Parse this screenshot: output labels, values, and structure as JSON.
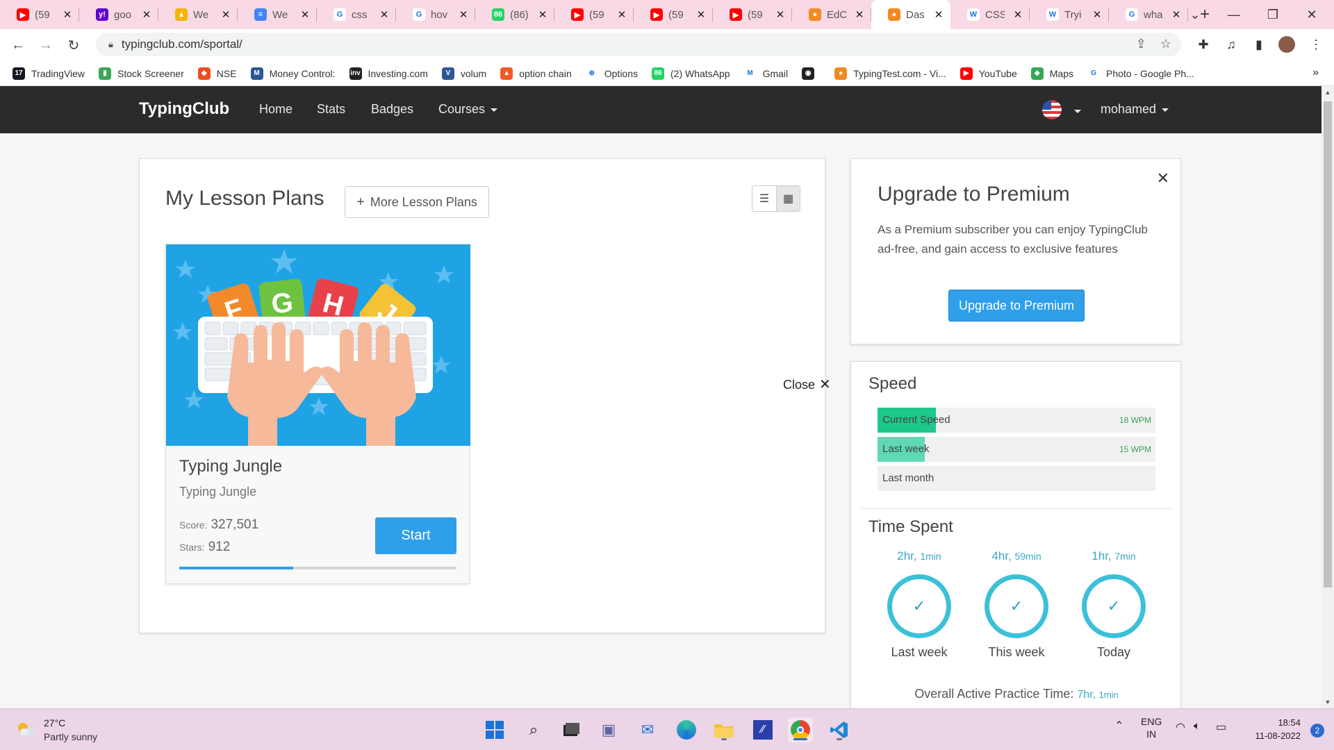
{
  "browser": {
    "tabs": [
      {
        "title": "(59",
        "favicon": "youtube-icon",
        "color": "#ff0000",
        "glyph": "▶"
      },
      {
        "title": "goo",
        "favicon": "yahoo-icon",
        "color": "#6001d2",
        "glyph": "y!"
      },
      {
        "title": "We",
        "favicon": "google-drive-icon",
        "color": "#f4b400",
        "glyph": "▲"
      },
      {
        "title": "We",
        "favicon": "google-docs-icon",
        "color": "#4285f4",
        "glyph": "≡"
      },
      {
        "title": "css",
        "favicon": "google-icon",
        "color": "#ffffff",
        "glyph": "G"
      },
      {
        "title": "hov",
        "favicon": "google-icon",
        "color": "#ffffff",
        "glyph": "G"
      },
      {
        "title": "(86)",
        "favicon": "whatsapp-icon",
        "color": "#25d366",
        "glyph": "86"
      },
      {
        "title": "(59",
        "favicon": "youtube-icon",
        "color": "#ff0000",
        "glyph": "▶"
      },
      {
        "title": "(59",
        "favicon": "youtube-icon",
        "color": "#ff0000",
        "glyph": "▶"
      },
      {
        "title": "(59",
        "favicon": "youtube-icon",
        "color": "#ff0000",
        "glyph": "▶"
      },
      {
        "title": "EdC",
        "favicon": "typingclub-icon",
        "color": "#f08a24",
        "glyph": "●"
      },
      {
        "title": "Das",
        "favicon": "typingclub-icon",
        "color": "#f08a24",
        "glyph": "●",
        "active": true
      },
      {
        "title": "CSS",
        "favicon": "w3schools-icon",
        "color": "#ffffff",
        "glyph": "W"
      },
      {
        "title": "Tryi",
        "favicon": "w3schools-icon",
        "color": "#ffffff",
        "glyph": "W"
      },
      {
        "title": "wha",
        "favicon": "google-icon",
        "color": "#ffffff",
        "glyph": "G"
      }
    ],
    "url": "typingclub.com/sportal/"
  },
  "bookmarks": [
    {
      "label": "TradingView",
      "icon": "tradingview-icon",
      "color": "#131722",
      "glyph": "17"
    },
    {
      "label": "Stock Screener",
      "icon": "bar-chart-icon",
      "color": "#3aa757",
      "glyph": "▮"
    },
    {
      "label": "NSE",
      "icon": "nse-icon",
      "color": "#e8501e",
      "glyph": "◆"
    },
    {
      "label": "Money Control:",
      "icon": "moneycontrol-icon",
      "color": "#2b5797",
      "glyph": "M"
    },
    {
      "label": "Investing.com",
      "icon": "investing-icon",
      "color": "#222222",
      "glyph": "inv"
    },
    {
      "label": "volum",
      "icon": "volume-icon",
      "color": "#2b5797",
      "glyph": "V"
    },
    {
      "label": "option chain",
      "icon": "option-chain-icon",
      "color": "#f05a28",
      "glyph": "▲"
    },
    {
      "label": "Options",
      "icon": "link-icon",
      "color": "#ffffff",
      "glyph": "⊕"
    },
    {
      "label": "(2) WhatsApp",
      "icon": "whatsapp-icon",
      "color": "#25d366",
      "glyph": "86"
    },
    {
      "label": "Gmail",
      "icon": "gmail-icon",
      "color": "#ffffff",
      "glyph": "M"
    },
    {
      "label": "",
      "icon": "globe-icon",
      "color": "#222222",
      "glyph": "◉"
    },
    {
      "label": "TypingTest.com - Vi...",
      "icon": "typingtest-icon",
      "color": "#f08a24",
      "glyph": "●"
    },
    {
      "label": "YouTube",
      "icon": "youtube-icon",
      "color": "#ff0000",
      "glyph": "▶"
    },
    {
      "label": "Maps",
      "icon": "maps-icon",
      "color": "#34a853",
      "glyph": "◆"
    },
    {
      "label": "Photo - Google Ph...",
      "icon": "google-icon",
      "color": "#ffffff",
      "glyph": "G"
    }
  ],
  "navbar": {
    "brand": "TypingClub",
    "links": [
      "Home",
      "Stats",
      "Badges"
    ],
    "courses": "Courses",
    "user": "mohamed"
  },
  "lessons": {
    "title": "My Lesson Plans",
    "more_label": "More Lesson Plans",
    "card": {
      "title": "Typing Jungle",
      "subtitle": "Typing Jungle",
      "score_label": "Score:",
      "score": "327,501",
      "stars_label": "Stars:",
      "stars": "912",
      "start_label": "Start",
      "progress": 0.41,
      "letters": [
        "F",
        "G",
        "H",
        "J"
      ]
    },
    "close_label": "Close"
  },
  "premium": {
    "title": "Upgrade to Premium",
    "text": "As a Premium subscriber you can enjoy TypingClub ad-free, and gain access to exclusive features",
    "button": "Upgrade to Premium"
  },
  "speed": {
    "title": "Speed",
    "rows": [
      {
        "label": "Current Speed",
        "value": "18 WPM",
        "fill": 0.21,
        "color": "#1ec88a"
      },
      {
        "label": "Last week",
        "value": "15 WPM",
        "fill": 0.17,
        "color": "#5ed9b4"
      },
      {
        "label": "Last month",
        "value": "",
        "fill": 0,
        "color": "#1ec88a"
      }
    ]
  },
  "time_spent": {
    "title": "Time Spent",
    "items": [
      {
        "h": "2hr,",
        "m": "1min",
        "label": "Last week"
      },
      {
        "h": "4hr,",
        "m": "59min",
        "label": "This week"
      },
      {
        "h": "1hr,",
        "m": "7min",
        "label": "Today"
      }
    ],
    "overall_label": "Overall Active Practice Time:",
    "overall_h": "7hr,",
    "overall_m": "1min"
  },
  "taskbar": {
    "temp": "27°C",
    "weather": "Partly sunny",
    "lang1": "ENG",
    "lang2": "IN",
    "time": "18:54",
    "date": "11-08-2022",
    "notifications": "2"
  }
}
